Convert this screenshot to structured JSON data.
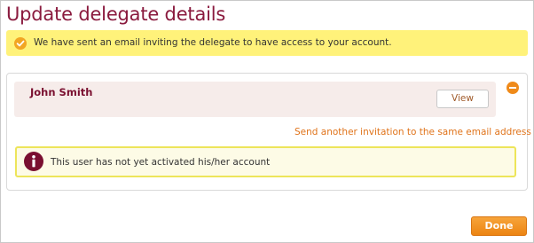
{
  "page": {
    "title": "Update delegate details"
  },
  "notice": {
    "icon": "check-circle-icon",
    "text": "We have sent an email inviting the delegate to have access to your account."
  },
  "delegate": {
    "name": "John Smith",
    "view_label": "View",
    "collapse_icon": "minus-circle-icon",
    "resend_link": "Send another invitation to the same email address",
    "status_icon": "info-icon",
    "status_text": "This user has not yet activated his/her account"
  },
  "footer": {
    "done_label": "Done"
  },
  "colors": {
    "title": "#8a1a3e",
    "notice_bg": "#fff27a",
    "accent_orange": "#e0731a",
    "info_border": "#ede55a",
    "delegate_row_bg": "#f6ecea"
  }
}
